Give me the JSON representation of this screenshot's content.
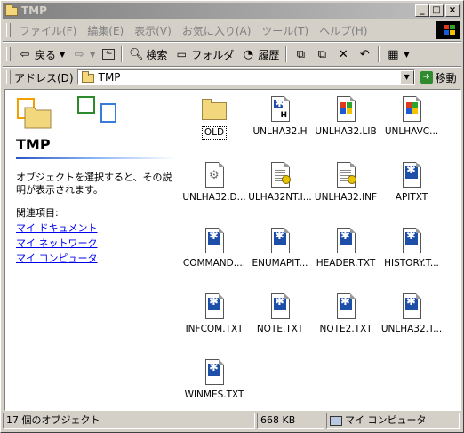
{
  "window": {
    "title": "TMP",
    "controls": {
      "minimize": "_",
      "maximize": "□",
      "close": "×"
    }
  },
  "menubar": {
    "items": [
      "ファイル(F)",
      "編集(E)",
      "表示(V)",
      "お気に入り(A)",
      "ツール(T)",
      "ヘルプ(H)"
    ]
  },
  "toolbar": {
    "back": "戻る",
    "search": "検索",
    "folders": "フォルダ",
    "history": "履歴",
    "icons": [
      "back-arrow-icon",
      "forward-arrow-icon",
      "up-folder-icon",
      "search-icon",
      "folders-icon",
      "history-icon",
      "move-to-icon",
      "copy-to-icon",
      "delete-icon",
      "undo-icon",
      "views-icon"
    ]
  },
  "address": {
    "label": "アドレス(D)",
    "value": "TMP",
    "go": "移動"
  },
  "sidebar": {
    "title": "TMP",
    "description": "オブジェクトを選択すると、その説明が表示されます。",
    "related_heading": "関連項目:",
    "links": [
      "マイ ドキュメント",
      "マイ ネットワーク",
      "マイ コンピュータ"
    ]
  },
  "files": [
    {
      "name": "OLD",
      "type": "folder"
    },
    {
      "name": "UNLHA32.H",
      "type": "header"
    },
    {
      "name": "UNLHA32.LIB",
      "type": "lib"
    },
    {
      "name": "UNLHAVC...",
      "type": "lib"
    },
    {
      "name": "UNLHA32.D...",
      "type": "dll"
    },
    {
      "name": "ULHA32NT.I...",
      "type": "inf"
    },
    {
      "name": "UNLHA32.INF",
      "type": "inf"
    },
    {
      "name": "APITXT",
      "type": "text"
    },
    {
      "name": "COMMAND....",
      "type": "text"
    },
    {
      "name": "ENUMAPIT...",
      "type": "text"
    },
    {
      "name": "HEADER.TXT",
      "type": "text"
    },
    {
      "name": "HISTORY.T...",
      "type": "text"
    },
    {
      "name": "INFCOM.TXT",
      "type": "text"
    },
    {
      "name": "NOTE.TXT",
      "type": "text"
    },
    {
      "name": "NOTE2.TXT",
      "type": "text"
    },
    {
      "name": "UNLHA32.T...",
      "type": "text"
    },
    {
      "name": "WINMES.TXT",
      "type": "text"
    }
  ],
  "statusbar": {
    "objects": "17 個のオブジェクト",
    "size": "668 KB",
    "location": "マイ コンピュータ"
  },
  "colors": {
    "inactive_title_start": "#808080",
    "inactive_title_end": "#c0c0c0",
    "link": "#0000ee",
    "face": "#d4d0c8"
  }
}
